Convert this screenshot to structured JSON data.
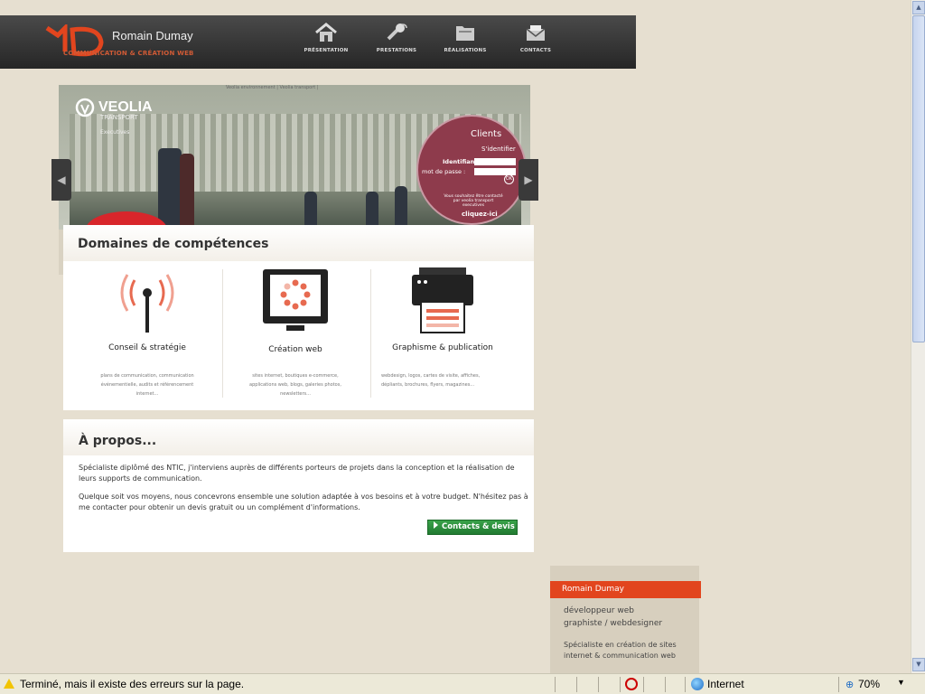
{
  "header": {
    "site_name": "Romain Dumay",
    "tagline": "COMMUNICATION & CRÉATION WEB",
    "nav": [
      {
        "label": "PRÉSENTATION",
        "icon": "home-icon"
      },
      {
        "label": "PRESTATIONS",
        "icon": "tools-icon"
      },
      {
        "label": "RÉALISATIONS",
        "icon": "folder-icon"
      },
      {
        "label": "CONTACTS",
        "icon": "mail-icon"
      }
    ]
  },
  "slider": {
    "breadcrumb": "Veolia environnement  |  Veolia transport  |",
    "brand": "VEOLIA",
    "brand_sub": "TRANSPORT",
    "brand_exec": "Executives",
    "clients_title": "Clients",
    "clients_signin": "S'identifier",
    "clients_login": "Identifiant :",
    "clients_password": "mot de passe :",
    "clients_ok": "OK",
    "clients_note": "Vous souhaitez être contacté par veolia transport executives",
    "clients_link": "cliquez-ici",
    "prev_arrow": "◀",
    "next_arrow": "▶"
  },
  "skills": {
    "title": "Domaines de compétences",
    "items": [
      {
        "title": "Conseil & stratégie",
        "desc": "plans de communication, communication événementielle, audits et référencement internet..."
      },
      {
        "title": "Création web",
        "desc": "sites internet, boutiques e-commerce, applications web, blogs, galeries photos, newsletters..."
      },
      {
        "title": "Graphisme & publication",
        "desc": "webdesign, logos, cartes de visite, affiches, dépliants, brochures, flyers, magazines..."
      }
    ]
  },
  "about": {
    "title": "À propos...",
    "p1": "Spécialiste diplômé des NTIC, j'interviens auprès de différents porteurs de projets dans la conception et la réalisation de leurs supports de communication.",
    "p2": "Quelque soit vos moyens, nous concevrons ensemble une solution adaptée à vos besoins et à votre budget. N'hésitez pas à me contacter pour obtenir un devis gratuit ou un complément d'informations.",
    "button": "Contacts & devis"
  },
  "card": {
    "name": "Romain Dumay",
    "role1": "développeur web",
    "role2": "graphiste / webdesigner",
    "spec1": "Spécialiste en création de sites",
    "spec2": "internet & communication web"
  },
  "scrollbar": {
    "up": "▲",
    "down": "▼"
  },
  "statusbar": {
    "message": "Terminé, mais il existe des erreurs sur la page.",
    "zone": "Internet",
    "zoom": "70%",
    "zoom_caret": "▼"
  },
  "colors": {
    "accent": "#e2451e",
    "header_bg": "#2f2f2f",
    "button": "#2a8a3a",
    "page_bg": "#e6dfd0"
  }
}
